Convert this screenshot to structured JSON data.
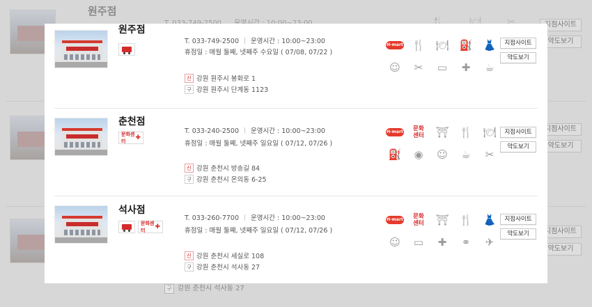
{
  "background": {
    "title": "원주점",
    "info_phone": "T. 033-749-2500",
    "info_hours": "운영시간 : 10:00~23:00",
    "buttons": [
      "지점사이트",
      "약도보기",
      "지점사이트",
      "약도보기",
      "지점사이트",
      "약도보기"
    ],
    "last_address_tag": "구",
    "last_address": "강원 춘천시 석사동 27"
  },
  "stores": [
    {
      "name": "원주점",
      "phone": "T. 033-749-2500",
      "hours": "운영시간 : 10:00~23:00",
      "closed": "휴점일 : 매월 둘째, 넷째주 수요일 ( 07/08, 07/22 )",
      "new_addr_tag": "신",
      "new_address": "강원 원주시 봉화로 1",
      "old_addr_tag": "구",
      "old_address": "강원 원주시 단계동 1123",
      "badges": [
        "delivery-truck"
      ],
      "icons": [
        "hmart-icon",
        "fork-knife-icon",
        "dining-plate-icon",
        "pharmacy-icon",
        "dress-icon",
        "kids-icon",
        "scissors-icon",
        "bandage-icon",
        "clinic-icon",
        "bubble-tea-icon"
      ],
      "site_button": "지점사이트",
      "map_button": "약도보기"
    },
    {
      "name": "춘천점",
      "phone": "T. 033-240-2500",
      "hours": "운영시간 : 10:00~23:00",
      "closed": "휴점일 : 매월 둘째, 넷째주 일요일 ( 07/12, 07/26 )",
      "new_addr_tag": "신",
      "new_address": "강원 춘천시 방송길 84",
      "old_addr_tag": "구",
      "old_address": "강원 춘천시 온의동 6-25",
      "badges": [
        "culture-center"
      ],
      "icons": [
        "hmart-icon",
        "culture-center-icon",
        "playground-icon",
        "fork-knife-icon",
        "dining-plate-icon",
        "pharmacy-icon",
        "photo-icon",
        "kids-icon",
        "bubble-tea-icon",
        "scissors-icon"
      ],
      "site_button": "지점사이트",
      "map_button": "약도보기"
    },
    {
      "name": "석사점",
      "phone": "T. 033-260-7700",
      "hours": "운영시간 : 10:00~23:00",
      "closed": "휴점일 : 매월 둘째, 넷째주 일요일 ( 07/12, 07/26 )",
      "new_addr_tag": "신",
      "new_address": "강원 춘천시 세실로 108",
      "old_addr_tag": "구",
      "old_address": "강원 춘천시 석사동 27",
      "badges": [
        "delivery-truck",
        "culture-center"
      ],
      "icons": [
        "hmart-icon",
        "culture-center-icon",
        "playground-icon",
        "fork-knife-icon",
        "dress-icon",
        "kids-icon",
        "bandage-icon",
        "clinic-icon",
        "glasses-icon",
        "airplane-icon"
      ],
      "site_button": "지점사이트",
      "map_button": "약도보기"
    }
  ],
  "labels": {
    "hmart": "H-mart",
    "culture_line1": "문화",
    "culture_line2": "센터",
    "center_badge": "문화센터"
  },
  "colors": {
    "accent": "#d42b2b",
    "overlay": "#d7d7d7"
  }
}
